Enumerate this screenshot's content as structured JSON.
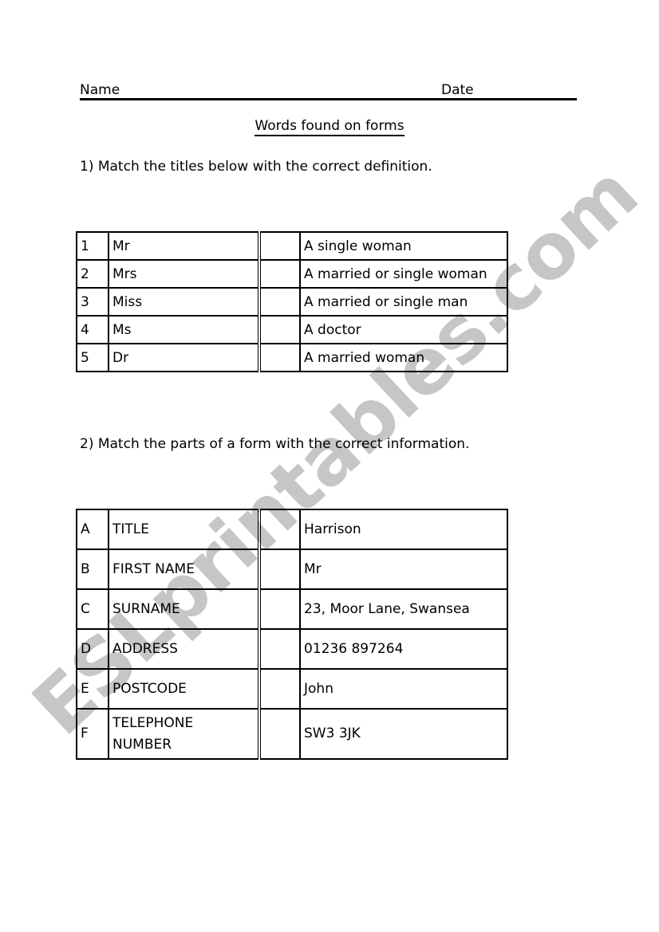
{
  "header": {
    "name_label": "Name",
    "date_label": "Date"
  },
  "title": "Words found on forms",
  "section1": {
    "instruction": "1) Match the titles below with the correct definition.",
    "rows": [
      {
        "key": "1",
        "term": "Mr",
        "answer": "",
        "definition": "A single woman"
      },
      {
        "key": "2",
        "term": "Mrs",
        "answer": "",
        "definition": "A married or single woman"
      },
      {
        "key": "3",
        "term": "Miss",
        "answer": "",
        "definition": "A married or single man"
      },
      {
        "key": "4",
        "term": "Ms",
        "answer": "",
        "definition": "A doctor"
      },
      {
        "key": "5",
        "term": "Dr",
        "answer": "",
        "definition": "A married woman"
      }
    ]
  },
  "section2": {
    "instruction": "2) Match the parts of a form with the correct information.",
    "rows": [
      {
        "key": "A",
        "term": "TITLE",
        "answer": "",
        "definition": "Harrison"
      },
      {
        "key": "B",
        "term": "FIRST NAME",
        "answer": "",
        "definition": "Mr"
      },
      {
        "key": "C",
        "term": "SURNAME",
        "answer": "",
        "definition": "23, Moor Lane, Swansea"
      },
      {
        "key": "D",
        "term": "ADDRESS",
        "answer": "",
        "definition": "01236 897264"
      },
      {
        "key": "E",
        "term": "POSTCODE",
        "answer": "",
        "definition": "John"
      },
      {
        "key": "F",
        "term": "TELEPHONE NUMBER",
        "answer": "",
        "definition": "SW3 3JK"
      }
    ]
  },
  "watermark": "ESLprintables.com",
  "colors": {
    "text": "#000000",
    "watermark": "#c6c6c6",
    "background": "#ffffff"
  }
}
